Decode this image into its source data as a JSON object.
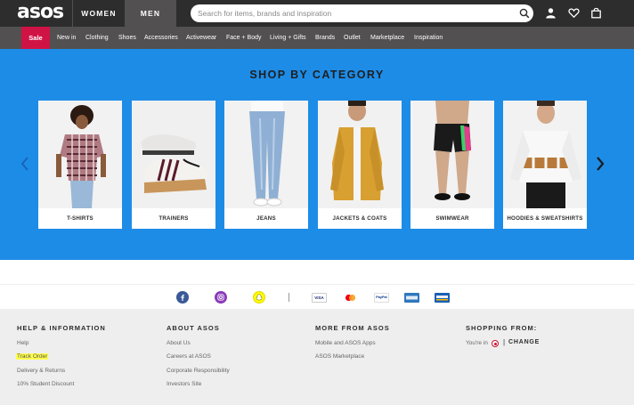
{
  "header": {
    "logo": "asos",
    "gender_tabs": [
      "WOMEN",
      "MEN"
    ],
    "search_placeholder": "Search for items, brands and inspiration",
    "icons": [
      "search-icon",
      "account-icon",
      "heart-icon",
      "bag-icon"
    ]
  },
  "nav": {
    "sale": "Sale",
    "items": [
      "New in",
      "Clothing",
      "Shoes",
      "Accessories",
      "Activewear",
      "Face + Body",
      "Living + Gifts",
      "Brands",
      "Outlet",
      "Marketplace",
      "Inspiration"
    ]
  },
  "categories": {
    "title": "SHOP BY CATEGORY",
    "items": [
      {
        "label": "T-SHIRTS"
      },
      {
        "label": "TRAINERS"
      },
      {
        "label": "JEANS"
      },
      {
        "label": "JACKETS & COATS"
      },
      {
        "label": "SWIMWEAR"
      },
      {
        "label": "HOODIES & SWEATSHIRTS"
      }
    ]
  },
  "social": [
    "facebook-icon",
    "instagram-icon",
    "snapchat-icon"
  ],
  "payments": [
    "VISA",
    "mastercard-icon",
    "PayPal",
    "amex-icon",
    "visa-electron-icon"
  ],
  "footer": {
    "columns": [
      {
        "heading": "HELP & INFORMATION",
        "links": [
          "Help",
          "Track Order",
          "Delivery & Returns",
          "10% Student Discount"
        ]
      },
      {
        "heading": "ABOUT ASOS",
        "links": [
          "About Us",
          "Careers at ASOS",
          "Corporate Responsibility",
          "Investors Site"
        ]
      },
      {
        "heading": "MORE FROM ASOS",
        "links": [
          "Mobile and ASOS Apps",
          "ASOS Marketplace"
        ]
      }
    ],
    "shopping_from": {
      "heading": "SHOPPING FROM:",
      "youre_in": "You're in",
      "divider": "|",
      "change": "CHANGE"
    }
  },
  "colors": {
    "header_bg": "#2d2d2d",
    "nav_bg": "#525050",
    "sale_bg": "#d01345",
    "banner_bg": "#1d8ce7",
    "footer_bg": "#eeeeee",
    "highlight": "#ffff4d"
  }
}
